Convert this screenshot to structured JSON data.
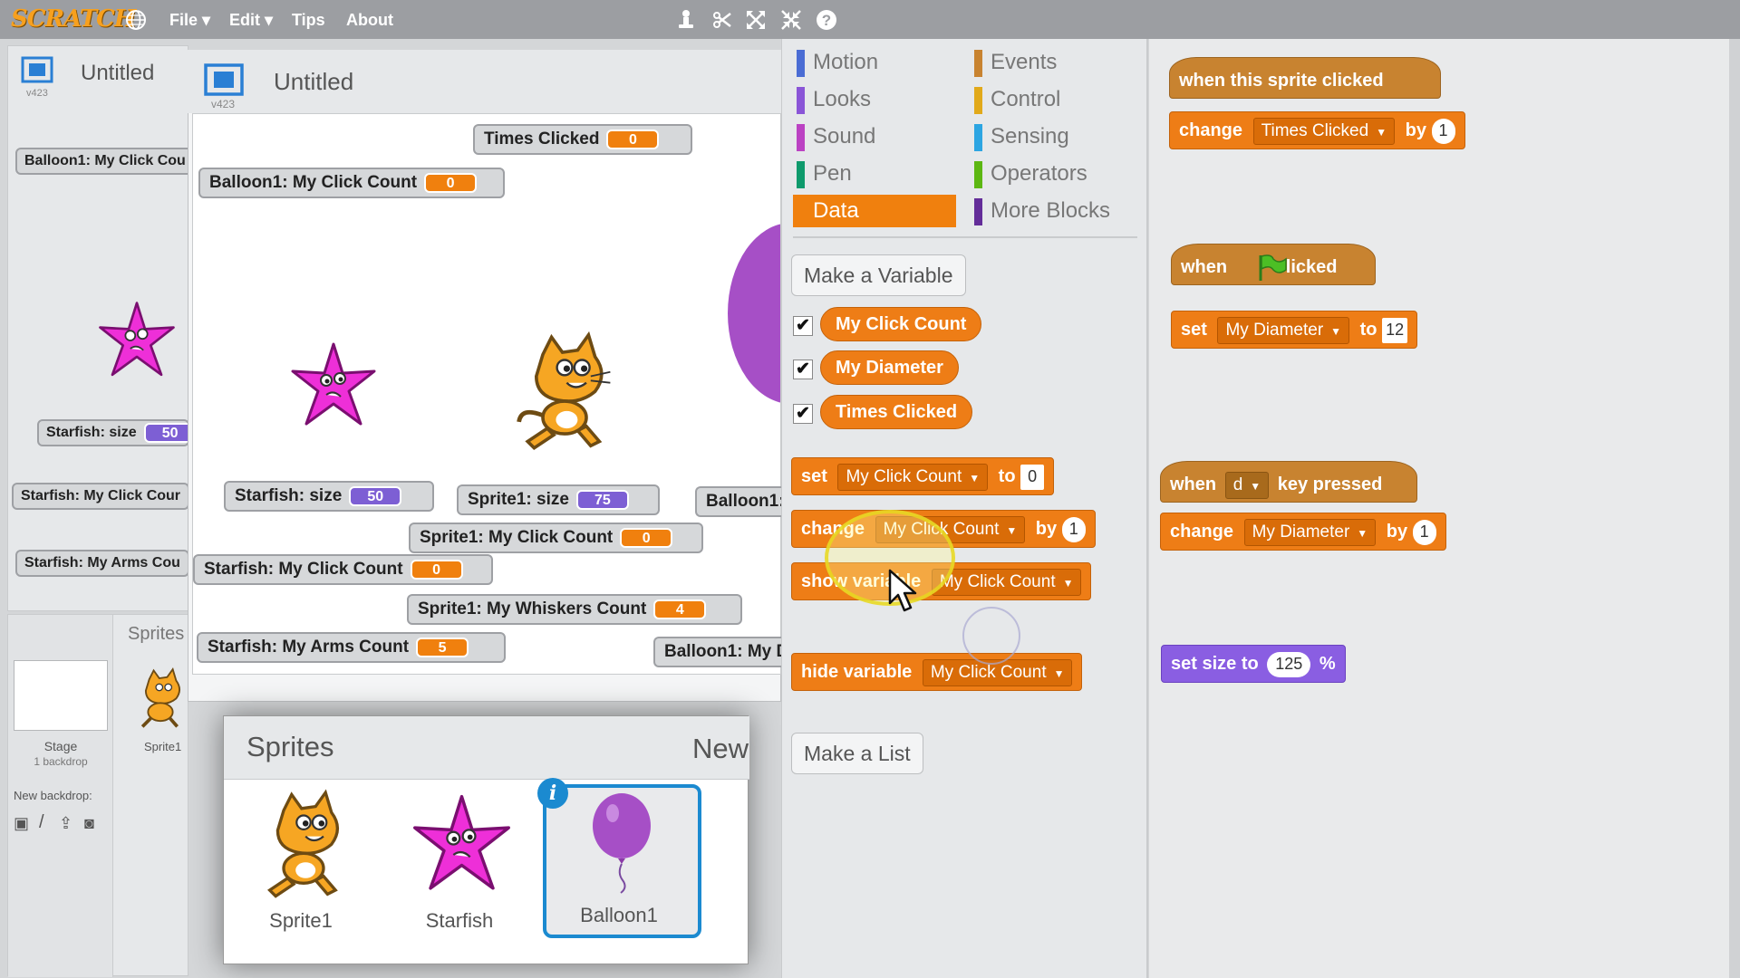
{
  "menubar": {
    "logo": "SCRATCH",
    "items": [
      "File ▾",
      "Edit ▾",
      "Tips",
      "About"
    ],
    "tools": [
      "duplicate-icon",
      "delete-icon",
      "grow-icon",
      "shrink-icon",
      "help-icon"
    ]
  },
  "bg_stage": {
    "title": "Untitled",
    "version": "v423",
    "monitors": [
      {
        "label": "Balloon1: My Click Cou"
      },
      {
        "label": "Starfish: size",
        "value": "50"
      },
      {
        "label": "Starfish: My Click Cour"
      },
      {
        "label": "Starfish: My Arms Cou"
      }
    ],
    "sprites_tab": "Sprites",
    "stage_label": "Stage",
    "stage_sub": "1 backdrop",
    "new_backdrop": "New backdrop:",
    "sprite1": "Sprite1"
  },
  "stage": {
    "title": "Untitled",
    "version": "v423",
    "monitors": [
      {
        "label": "Times Clicked",
        "value": "0",
        "color": "orange"
      },
      {
        "label": "Balloon1: My Click Count",
        "value": "0",
        "color": "orange"
      },
      {
        "label": "Starfish: size",
        "value": "50",
        "color": "purple"
      },
      {
        "label": "Sprite1: size",
        "value": "75",
        "color": "purple"
      },
      {
        "label": "Balloon1:",
        "value": "",
        "color": "none"
      },
      {
        "label": "Sprite1: My Click Count",
        "value": "0",
        "color": "orange"
      },
      {
        "label": "Starfish: My Click Count",
        "value": "0",
        "color": "orange"
      },
      {
        "label": "Sprite1: My Whiskers Count",
        "value": "4",
        "color": "orange"
      },
      {
        "label": "Starfish: My Arms Count",
        "value": "5",
        "color": "orange"
      },
      {
        "label": "Balloon1: My D",
        "value": "",
        "color": "none"
      }
    ]
  },
  "sprites_panel": {
    "title": "Sprites",
    "new_label": "New",
    "items": [
      {
        "name": "Sprite1"
      },
      {
        "name": "Starfish"
      },
      {
        "name": "Balloon1",
        "selected": true
      }
    ]
  },
  "palette": {
    "categories_left": [
      {
        "label": "Motion",
        "color": "#4a6cd4"
      },
      {
        "label": "Looks",
        "color": "#8a55d7"
      },
      {
        "label": "Sound",
        "color": "#bb42c3"
      },
      {
        "label": "Pen",
        "color": "#0e9a6c"
      },
      {
        "label": "Data",
        "color": "#ee7d16"
      }
    ],
    "categories_right": [
      {
        "label": "Events",
        "color": "#c88330"
      },
      {
        "label": "Control",
        "color": "#e1a91a"
      },
      {
        "label": "Sensing",
        "color": "#2ca5e2"
      },
      {
        "label": "Operators",
        "color": "#5cb712"
      },
      {
        "label": "More Blocks",
        "color": "#632d99"
      }
    ],
    "selected_category": "Data",
    "make_variable": "Make a Variable",
    "variables": [
      "My Click Count",
      "My Diameter",
      "Times Clicked"
    ],
    "blocks": {
      "set": {
        "kw": "set",
        "var": "My Click Count",
        "to": "to",
        "value": "0"
      },
      "change": {
        "kw": "change",
        "var": "My Click Count",
        "by": "by",
        "value": "1"
      },
      "show": {
        "kw": "show variable",
        "var": "My Click Count"
      },
      "hide": {
        "kw": "hide variable",
        "var": "My Click Count"
      }
    },
    "make_list": "Make a List"
  },
  "scripts": {
    "s1": {
      "hat": "when this sprite clicked",
      "kw": "change",
      "var": "Times Clicked",
      "by": "by",
      "value": "1"
    },
    "s2": {
      "hat_a": "when",
      "hat_b": "clicked",
      "kw": "set",
      "var": "My Diameter",
      "to": "to",
      "value": "12"
    },
    "s3": {
      "hat_a": "when",
      "key": "d",
      "hat_b": "key pressed",
      "kw": "change",
      "var": "My Diameter",
      "by": "by",
      "value": "1"
    },
    "s4": {
      "kw": "set size to",
      "value": "125",
      "unit": "%"
    }
  }
}
